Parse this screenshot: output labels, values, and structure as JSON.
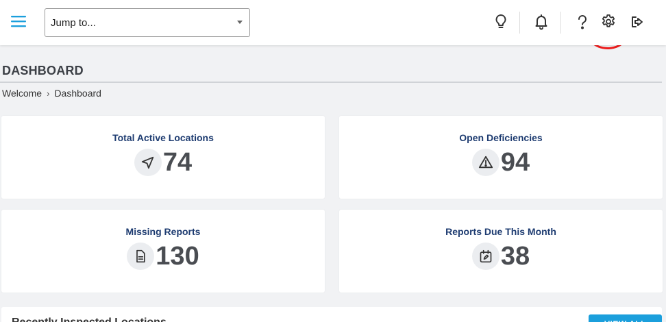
{
  "header": {
    "jump_placeholder": "Jump to...",
    "icons": [
      "menu-icon",
      "lightbulb-icon",
      "bell-icon",
      "help-icon",
      "gear-icon",
      "logout-icon"
    ],
    "accent_color": "#1b9fdc",
    "highlight_color": "#ee1c1c"
  },
  "page": {
    "title": "DASHBOARD",
    "breadcrumb": [
      "Welcome",
      "Dashboard"
    ],
    "breadcrumb_separator": "›"
  },
  "stats": [
    {
      "label": "Total Active Locations",
      "value": "74",
      "icon": "navigation-arrow-icon"
    },
    {
      "label": "Open Deficiencies",
      "value": "94",
      "icon": "warning-triangle-icon"
    },
    {
      "label": "Missing Reports",
      "value": "130",
      "icon": "document-icon"
    },
    {
      "label": "Reports Due This Month",
      "value": "38",
      "icon": "calendar-edit-icon"
    }
  ],
  "recent": {
    "title": "Recently Inspected Locations",
    "view_all_label": "VIEW ALL"
  }
}
